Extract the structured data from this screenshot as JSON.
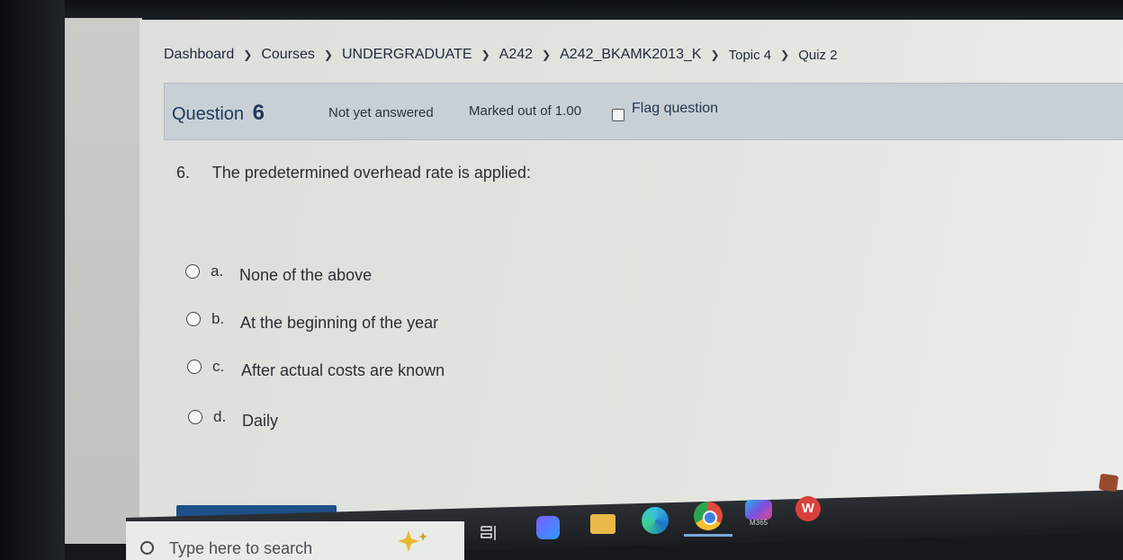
{
  "breadcrumb": [
    {
      "label": "Dashboard"
    },
    {
      "label": "Courses"
    },
    {
      "label": "UNDERGRADUATE"
    },
    {
      "label": "A242"
    },
    {
      "label": "A242_BKAMK2013_K"
    },
    {
      "label": "Topic 4"
    },
    {
      "label": "Quiz 2"
    }
  ],
  "question_info": {
    "title_prefix": "Question",
    "number": "6",
    "state": "Not yet answered",
    "marks": "Marked out of 1.00",
    "flag_label": "Flag question"
  },
  "question": {
    "number": "6.",
    "text": "The predetermined overhead rate is applied:"
  },
  "options": [
    {
      "letter": "a.",
      "text": "None of the above"
    },
    {
      "letter": "b.",
      "text": "At the beginning of the year"
    },
    {
      "letter": "c.",
      "text": "After actual costs are known"
    },
    {
      "letter": "d.",
      "text": "Daily"
    }
  ],
  "taskbar": {
    "search_placeholder": "Type here to search",
    "m365_label": "M365",
    "wps_glyph": "W",
    "icons": [
      "task-view-icon",
      "fluent-icon",
      "file-explorer-icon",
      "edge-icon",
      "chrome-icon",
      "m365-icon",
      "wps-office-icon"
    ]
  },
  "colors": {
    "info_bar": "#c9d0d5",
    "link": "#1f2a3a",
    "title": "#1e3a5a",
    "nav_button": "#1e4f88"
  }
}
